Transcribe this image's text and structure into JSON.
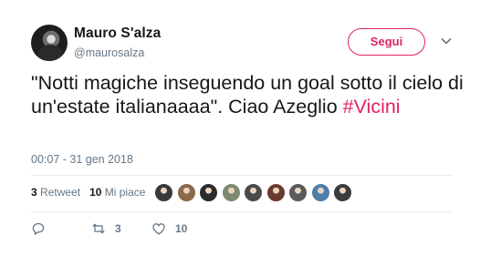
{
  "tweet": {
    "author_name": "Mauro S'alza",
    "author_handle": "@maurosalza",
    "follow_label": "Segui",
    "text_main": "\"Notti magiche inseguendo un goal sotto il cielo di un'estate italianaaaa\". Ciao Azeglio ",
    "hashtag": "#Vicini",
    "timestamp": "00:07 - 31 gen 2018",
    "retweet_count": "3",
    "retweet_label": "Retweet",
    "like_count": "10",
    "like_label": "Mi piace"
  },
  "actions": {
    "reply_count": "",
    "retweet_count": "3",
    "like_count": "10"
  },
  "likers": [
    {
      "icon": "avatar-1",
      "color": "#3a3a3a"
    },
    {
      "icon": "avatar-2",
      "color": "#8a6a4a"
    },
    {
      "icon": "avatar-3",
      "color": "#2b2b2b"
    },
    {
      "icon": "avatar-4",
      "color": "#7c8a6e"
    },
    {
      "icon": "avatar-5",
      "color": "#4a4a4a"
    },
    {
      "icon": "avatar-6",
      "color": "#6b3b2f"
    },
    {
      "icon": "avatar-7",
      "color": "#5a5a5a"
    },
    {
      "icon": "avatar-8",
      "color": "#4f7fa8"
    },
    {
      "icon": "avatar-9",
      "color": "#3c3c3c"
    }
  ],
  "colors": {
    "accent": "#e0245e",
    "secondary_text": "#657786"
  }
}
